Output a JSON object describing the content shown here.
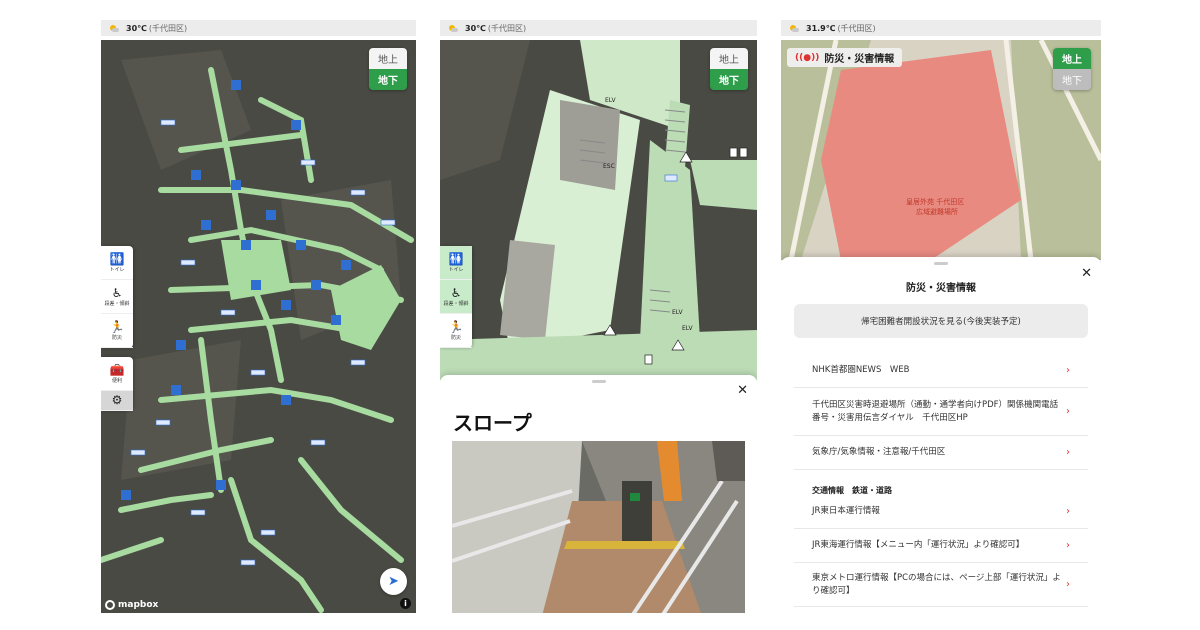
{
  "panels": [
    {
      "status": {
        "temp": "30℃",
        "location": "(千代田区)"
      },
      "level_toggle": {
        "above": "地上",
        "below": "地下",
        "active": "below"
      },
      "sidebar": [
        {
          "icon": "restroom-icon",
          "glyph": "🚻",
          "label": "トイレ"
        },
        {
          "icon": "wheelchair-icon",
          "glyph": "♿",
          "label": "段差・傾斜"
        },
        {
          "icon": "evacuation-icon",
          "glyph": "🏃",
          "label": "防災"
        },
        {
          "icon": "facility-icon",
          "glyph": "🧰",
          "label": "便利"
        },
        {
          "icon": "gear-icon",
          "glyph": "⚙",
          "label": ""
        }
      ],
      "mapbox": "mapbox",
      "info": "i"
    },
    {
      "status": {
        "temp": "30℃",
        "location": "(千代田区)"
      },
      "level_toggle": {
        "above": "地上",
        "below": "地下",
        "active": "below"
      },
      "sidebar": [
        {
          "icon": "restroom-icon",
          "glyph": "🚻",
          "label": "トイレ"
        },
        {
          "icon": "wheelchair-icon",
          "glyph": "♿",
          "label": "段差・傾斜"
        },
        {
          "icon": "evacuation-icon",
          "glyph": "🏃",
          "label": "防災"
        }
      ],
      "map_labels": [
        "ELV",
        "ESC",
        "ELV",
        "ELV"
      ],
      "sheet": {
        "title": "スロープ"
      }
    },
    {
      "status": {
        "temp": "31.9℃",
        "location": "(千代田区)"
      },
      "level_toggle": {
        "above": "地上",
        "below": "地下",
        "active": "above"
      },
      "alert_chip": "防災・災害情報",
      "map_label": "皇居外苑 千代田区\n広域避難場所",
      "sheet": {
        "title": "防災・災害情報",
        "shelter_button": "帰宅困難者開設状況を見る(今後実装予定)",
        "links": [
          "NHK首都圏NEWS　WEB",
          "千代田区災害時退避場所（通勤・通学者向けPDF）関係機関電話番号・災害用伝言ダイヤル　千代田区HP",
          "気象庁/気象情報・注意報/千代田区"
        ],
        "section": "交通情報　鉄道・道路",
        "transit_links": [
          "JR東日本運行情報",
          "JR東海運行情報【メニュー内「運行状況」より確認可】",
          "東京メトロ運行情報【PCの場合には、ページ上部「運行状況」より確認可】"
        ]
      }
    }
  ],
  "colors": {
    "accent": "#2e9e4b",
    "map_dark": "#4a4a44",
    "path": "#a7dba0",
    "alert": "#dd3333"
  }
}
